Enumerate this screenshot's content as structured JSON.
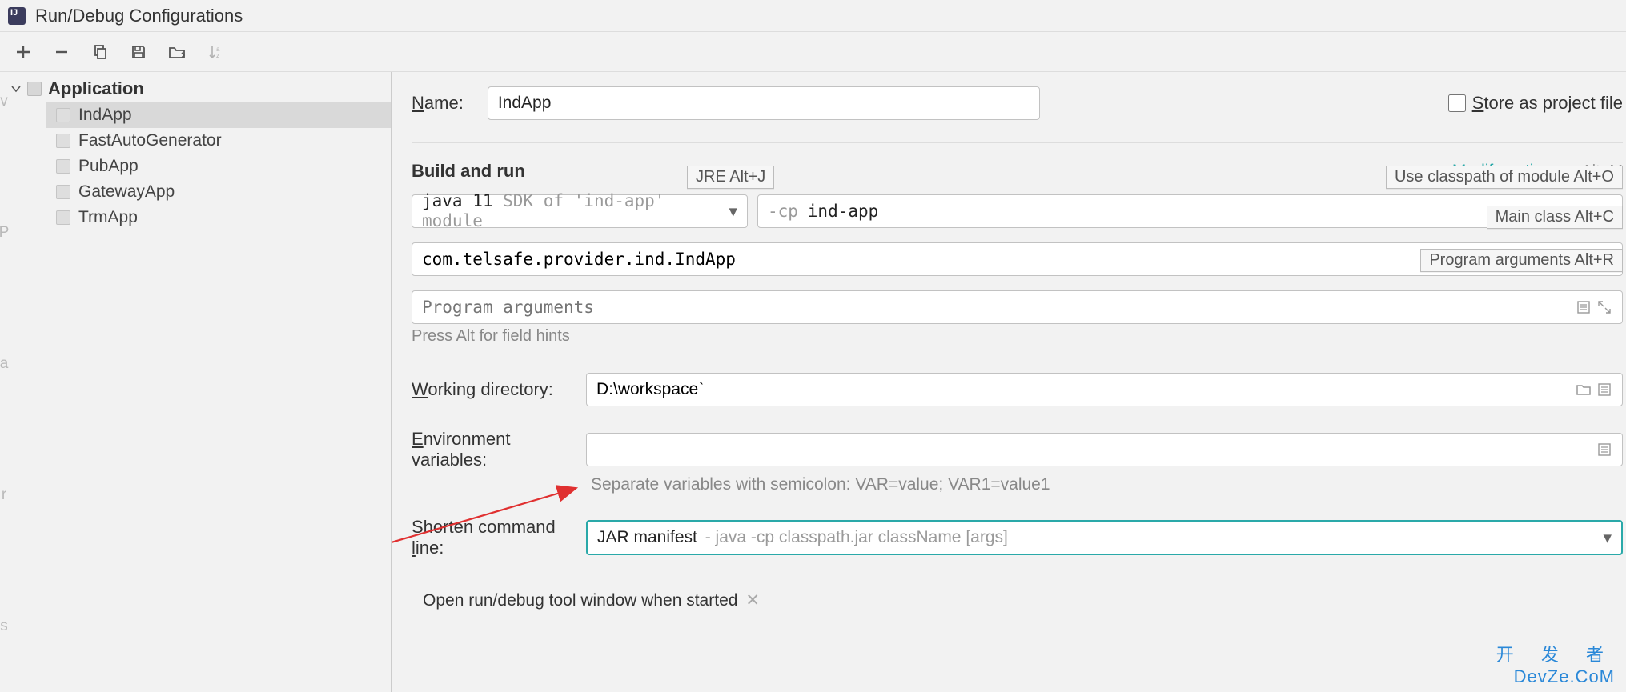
{
  "window": {
    "title": "Run/Debug Configurations"
  },
  "toolbar": {
    "add_tooltip": "Add",
    "remove_tooltip": "Remove",
    "copy_tooltip": "Copy",
    "save_tooltip": "Save",
    "folder_tooltip": "Move into folder",
    "sort_tooltip": "Sort alphabetically"
  },
  "tree": {
    "root_label": "Application",
    "items": [
      {
        "label": "IndApp",
        "selected": true
      },
      {
        "label": "FastAutoGenerator",
        "selected": false
      },
      {
        "label": "PubApp",
        "selected": false
      },
      {
        "label": "GatewayApp",
        "selected": false
      },
      {
        "label": "TrmApp",
        "selected": false
      }
    ]
  },
  "form": {
    "name_label": "Name:",
    "name_value": "IndApp",
    "store_label": "Store as project file",
    "build_run_title": "Build and run",
    "modify_options_label": "Modify options",
    "modify_options_shortcut": "Alt+M",
    "jre_hint": "JRE Alt+J",
    "classpath_hint": "Use classpath of module Alt+O",
    "mainclass_hint": "Main class Alt+C",
    "progargs_hint": "Program arguments Alt+R",
    "java_select_prefix": "java 11",
    "java_select_suffix": " SDK of 'ind-app' module",
    "cp_prefix": "-cp",
    "cp_value": "ind-app",
    "main_class_value": "com.telsafe.provider.ind.IndApp",
    "program_args_placeholder": "Program arguments",
    "press_alt_hint": "Press Alt for field hints",
    "workdir_label": "Working directory:",
    "workdir_value": "D:\\workspace`",
    "envvars_label": "Environment variables:",
    "envvars_value": "",
    "envvars_hint": "Separate variables with semicolon: VAR=value; VAR1=value1",
    "shorten_label": "Shorten command line:",
    "shorten_value_strong": "JAR manifest",
    "shorten_value_gray": " - java -cp classpath.jar className [args]",
    "open_when_started": "Open run/debug tool window when started"
  },
  "watermark": {
    "top": "开 发 者",
    "bottom": "DevZe.CoM"
  }
}
